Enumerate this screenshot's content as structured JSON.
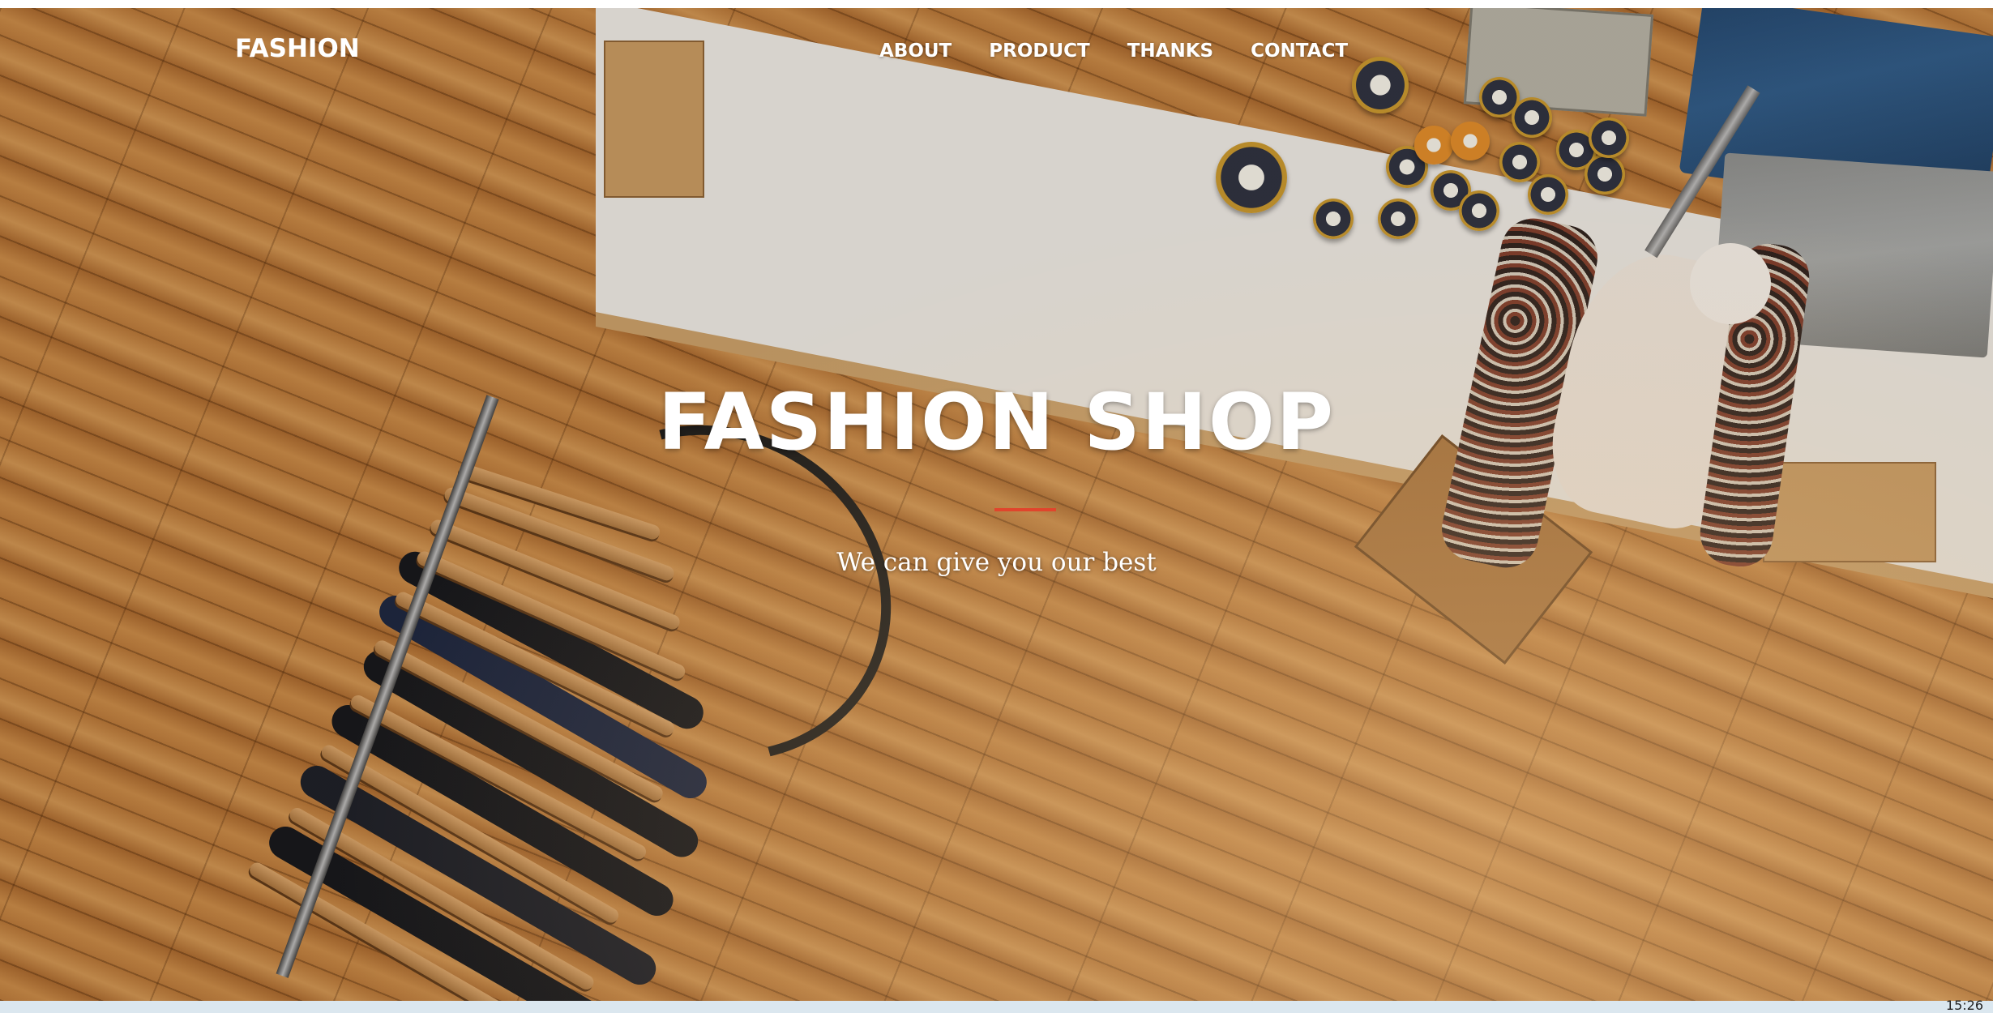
{
  "navbar": {
    "brand": "FASHION",
    "links": [
      {
        "label": "ABOUT"
      },
      {
        "label": "PRODUCT"
      },
      {
        "label": "THANKS"
      },
      {
        "label": "CONTACT"
      }
    ]
  },
  "hero": {
    "title": "FASHION SHOP",
    "subtitle": "We can give you our best",
    "background_image": "overhead view of clothing store with wooden floor, clothes rack, table with jars, mannequin"
  },
  "taskbar": {
    "clock": "15:26"
  },
  "colors": {
    "text": "#ffffff",
    "divider_accent": "#e0452c",
    "floor_wood": "#b8793b",
    "taskbar": "#dbe7ef"
  }
}
